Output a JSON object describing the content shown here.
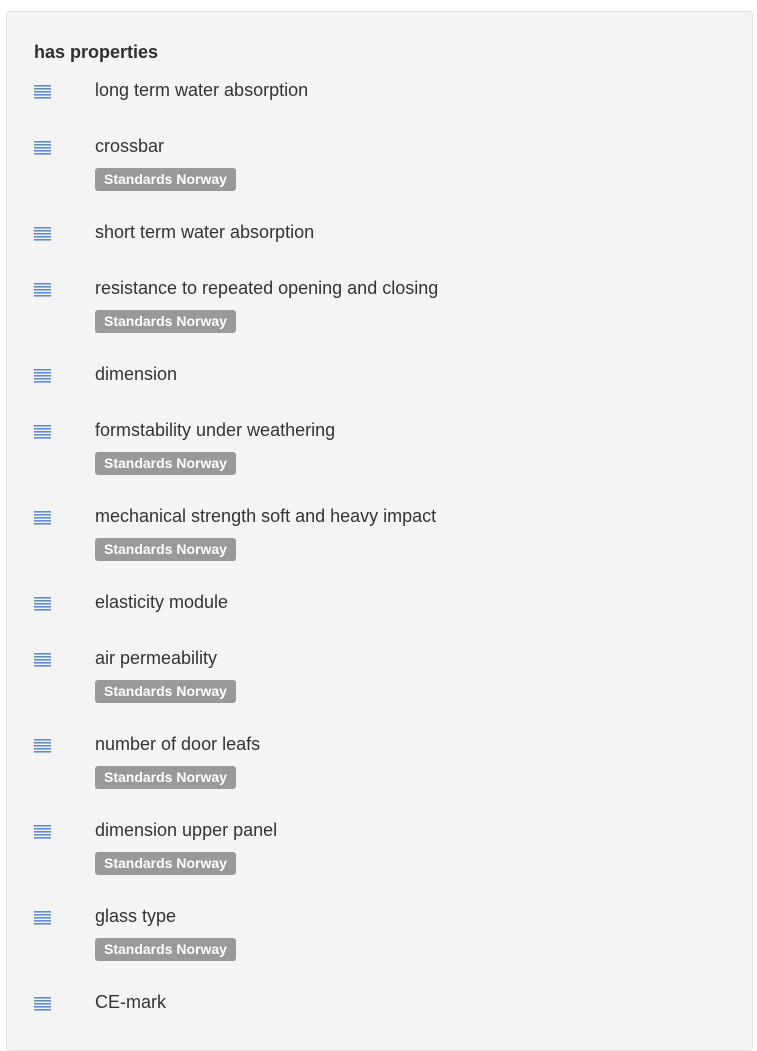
{
  "section": {
    "title": "has properties"
  },
  "badge_label": "Standards Norway",
  "properties": [
    {
      "label": "long term water absorption",
      "badge": null
    },
    {
      "label": "crossbar",
      "badge": "Standards Norway"
    },
    {
      "label": "short term water absorption",
      "badge": null
    },
    {
      "label": "resistance to repeated opening and closing",
      "badge": "Standards Norway"
    },
    {
      "label": "dimension",
      "badge": null
    },
    {
      "label": "formstability under weathering",
      "badge": "Standards Norway"
    },
    {
      "label": "mechanical strength soft and heavy impact",
      "badge": "Standards Norway"
    },
    {
      "label": "elasticity module",
      "badge": null
    },
    {
      "label": "air permeability",
      "badge": "Standards Norway"
    },
    {
      "label": "number of door leafs",
      "badge": "Standards Norway"
    },
    {
      "label": "dimension upper panel",
      "badge": "Standards Norway"
    },
    {
      "label": "glass type",
      "badge": "Standards Norway"
    },
    {
      "label": "CE-mark",
      "badge": null
    }
  ],
  "colors": {
    "icon": "#5b8fd1",
    "badge_bg": "#999999",
    "panel_bg": "#f4f4f4"
  },
  "icons": {
    "list": "list-lines-icon"
  }
}
